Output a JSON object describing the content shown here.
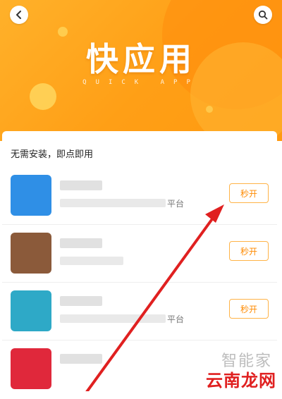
{
  "header": {
    "title": "快应用",
    "subtitle": "QUICK APP",
    "back_icon": "chevron-left-icon",
    "search_icon": "search-icon"
  },
  "section": {
    "title": "无需安装，即点即用"
  },
  "apps": [
    {
      "desc_suffix": "平台",
      "button_label": "秒开",
      "icon_color": "#2f8fe6"
    },
    {
      "desc_suffix": "",
      "button_label": "秒开",
      "icon_color": "#8b5a3a"
    },
    {
      "desc_suffix": "平台",
      "button_label": "秒开",
      "icon_color": "#2ea9c7"
    },
    {
      "desc_suffix": "",
      "button_label": "",
      "icon_color": "#e0283b"
    }
  ],
  "watermark": {
    "line1": "智能家",
    "line2": "云南龙网"
  },
  "colors": {
    "accent": "#ff9a10",
    "button_text": "#ff8a00",
    "annotation_arrow": "#e02020"
  }
}
